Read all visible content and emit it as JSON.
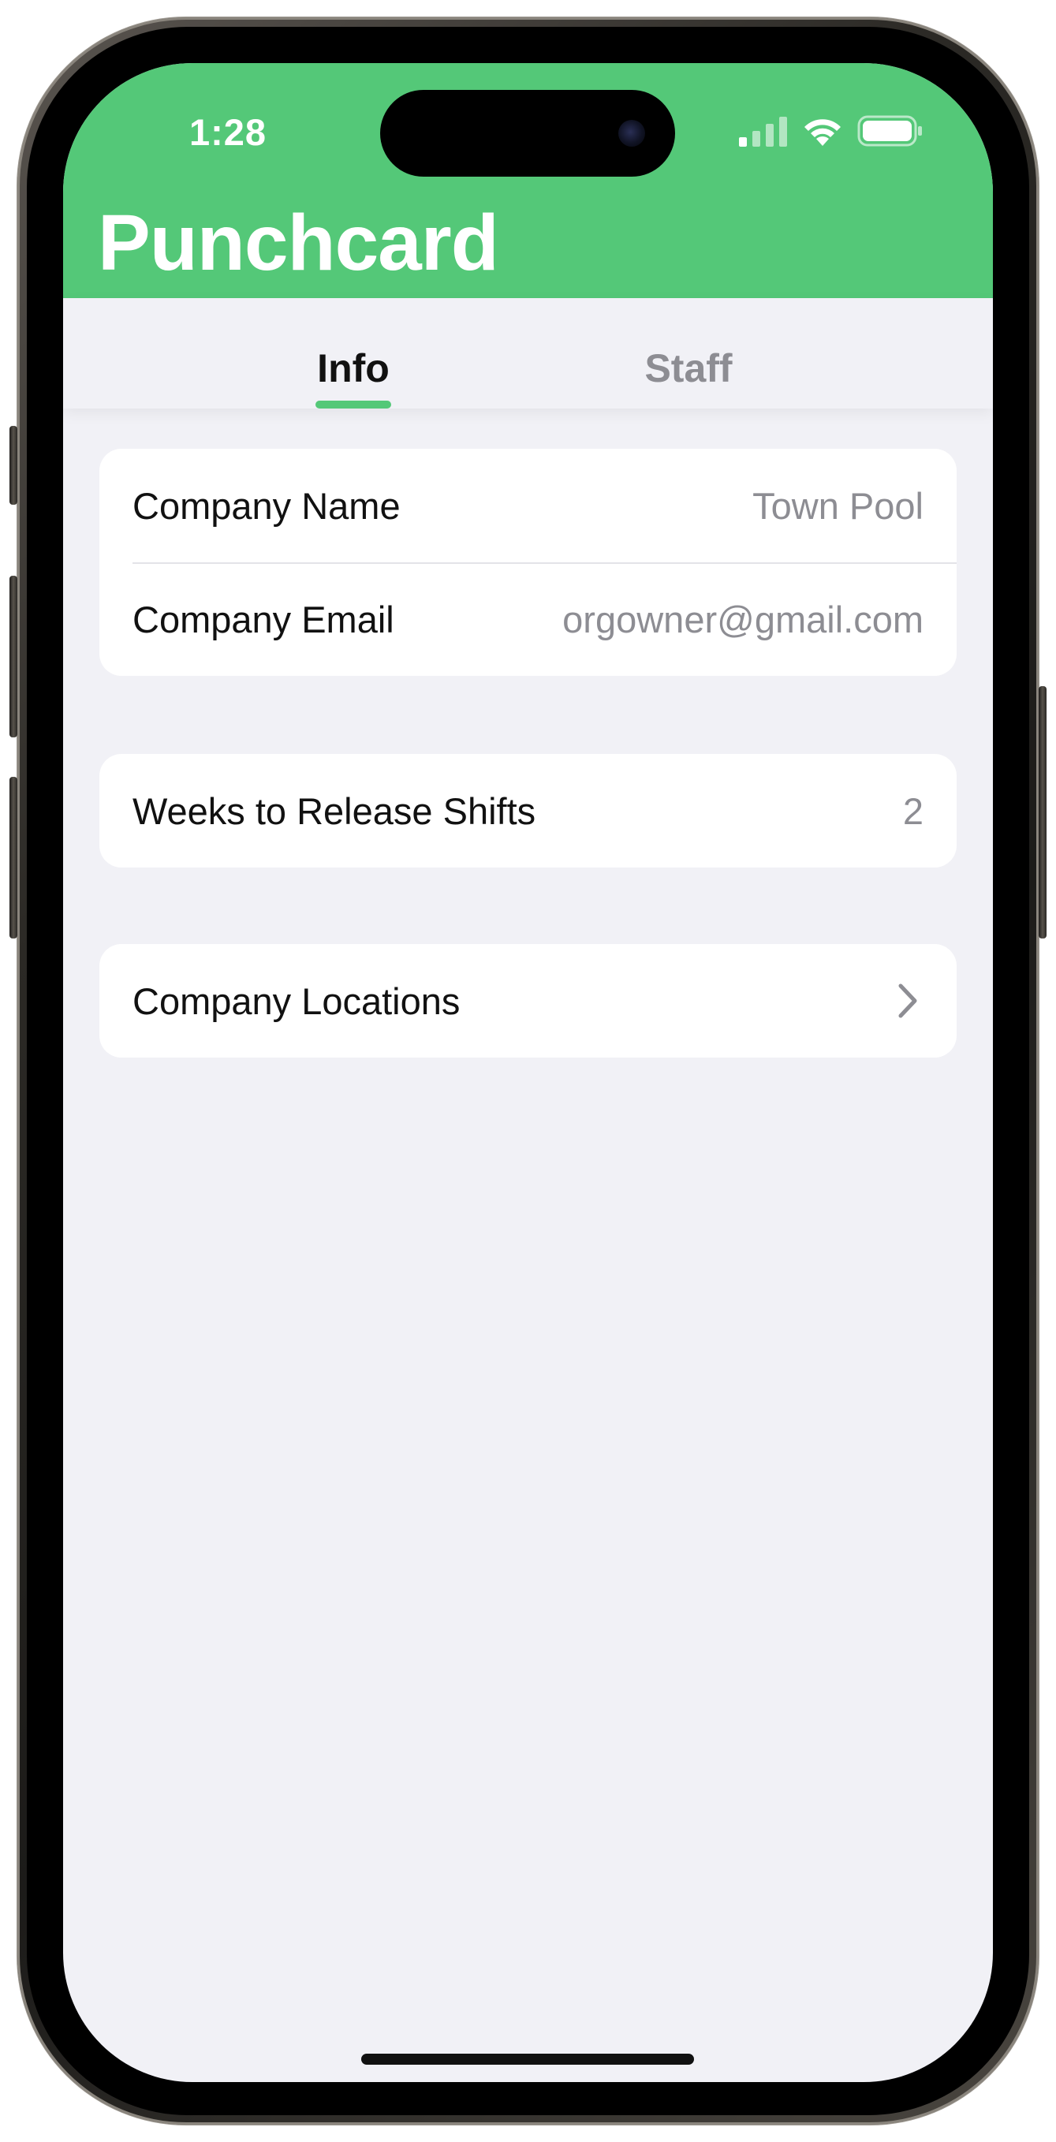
{
  "status_bar": {
    "time": "1:28",
    "icons": [
      "cellular-signal-icon",
      "wifi-icon",
      "battery-icon"
    ]
  },
  "app": {
    "title": "Punchcard",
    "accent_color": "#54c878"
  },
  "tabs": [
    {
      "label": "Info",
      "selected": true
    },
    {
      "label": "Staff",
      "selected": false
    }
  ],
  "company_info": {
    "name_label": "Company Name",
    "name_value": "Town Pool",
    "email_label": "Company Email",
    "email_value": "orgowner@gmail.com"
  },
  "release_settings": {
    "weeks_label": "Weeks to Release Shifts",
    "weeks_value": "2"
  },
  "locations": {
    "label": "Company Locations",
    "icon": "chevron-right-icon"
  }
}
